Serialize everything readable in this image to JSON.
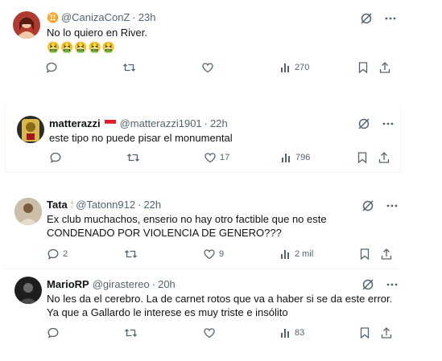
{
  "tweets": [
    {
      "name": "",
      "name_emoji": "♊",
      "handle": "@CanizaConZ",
      "dot": "·",
      "time": "23h",
      "text": "No lo quiero en River.",
      "text2": "🤮🤮🤮🤮🤮",
      "replies": "",
      "retweets": "",
      "likes": "",
      "views": "270",
      "colors": {
        "avatar_bg": "#b03a2e",
        "avatar_fg": "#f0c9a8"
      }
    },
    {
      "name": "matterazzi",
      "name_emoji": "🇮🇩",
      "handle": "@matterazzi1901",
      "dot": "·",
      "time": "22h",
      "text": "este tipo no puede pisar el monumental",
      "replies": "",
      "retweets": "",
      "likes": "17",
      "views": "796",
      "colors": {
        "avatar_bg": "#2b2b2b",
        "avatar_fg": "#d8b84a"
      }
    },
    {
      "name": "Tata",
      "name_emoji": "🕯",
      "handle": "@Tatonn912",
      "dot": "·",
      "time": "22h",
      "text": "Ex club muchachos, enserio no hay otro factible que no este CONDENADO POR VIOLENCIA DE GENERO???",
      "replies": "2",
      "retweets": "",
      "likes": "9",
      "views": "2 mil",
      "colors": {
        "avatar_bg": "#8e7d66",
        "avatar_fg": "#e6dccb"
      }
    },
    {
      "name": "MarioRP",
      "name_emoji": "",
      "handle": "@girastereo",
      "dot": "·",
      "time": "20h",
      "text": "No les da el cerebro. La de carnet rotos que va a haber si se da este error. Ya que a Gallardo le interese es muy triste e insólito",
      "replies": "",
      "retweets": "",
      "likes": "",
      "views": "83",
      "colors": {
        "avatar_bg": "#1e1e1e",
        "avatar_fg": "#6b6b6b"
      }
    }
  ]
}
